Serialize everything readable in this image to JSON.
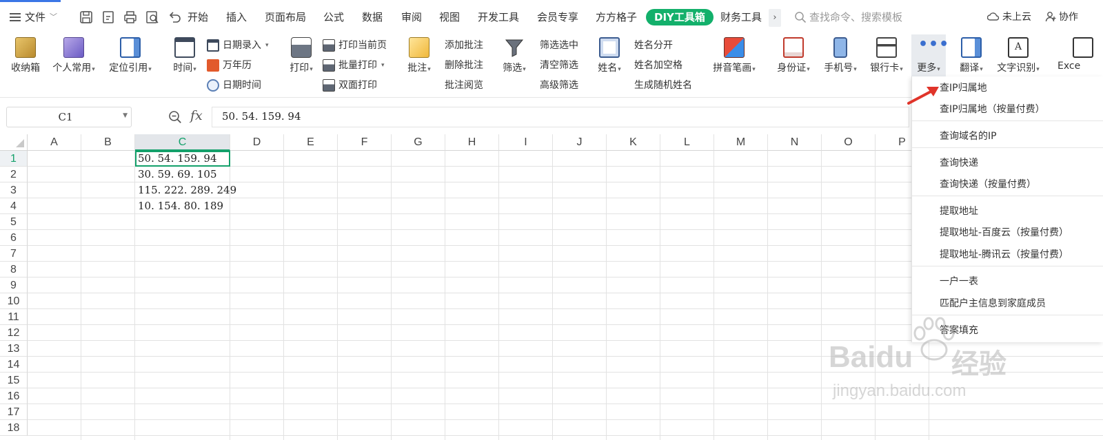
{
  "menubar": {
    "file": "文件",
    "tabs": [
      "开始",
      "插入",
      "页面布局",
      "公式",
      "数据",
      "审阅",
      "视图",
      "开发工具",
      "会员专享",
      "方方格子"
    ],
    "diy_tab": "DIY工具箱",
    "finance_tab": "财务工具",
    "more_tabs": "›",
    "search_placeholder": "查找命令、搜索模板",
    "cloud": "未上云",
    "collab": "协作"
  },
  "ribbon": {
    "toolbox": "收纳箱",
    "personal": "个人常用",
    "locate": "定位引用",
    "time": "时间",
    "date_entry": "日期录入",
    "perpetual_calendar": "万年历",
    "date_time": "日期时间",
    "print": "打印",
    "print_current": "打印当前页",
    "batch_print": "批量打印",
    "duplex_print": "双面打印",
    "annotation": "批注",
    "add_annotation": "添加批注",
    "delete_annotation": "删除批注",
    "read_annotation": "批注阅览",
    "filter": "筛选",
    "filter_selected": "筛选选中",
    "clear_filter": "清空筛选",
    "advanced_filter": "高级筛选",
    "name": "姓名",
    "split_name": "姓名分开",
    "name_add_space": "姓名加空格",
    "random_name": "生成随机姓名",
    "pinyin": "拼音笔画",
    "id_card": "身份证",
    "phone": "手机号",
    "bank_card": "银行卡",
    "more": "更多",
    "translate": "翻译",
    "ocr": "文字识别",
    "excel_cut": "Exce"
  },
  "formula": {
    "cell_ref": "C1",
    "fx": "fx",
    "value": "50. 54. 159. 94"
  },
  "grid": {
    "columns": [
      "A",
      "B",
      "C",
      "D",
      "E",
      "F",
      "G",
      "H",
      "I",
      "J",
      "K",
      "L",
      "M",
      "N",
      "O",
      "P"
    ],
    "rows": [
      "1",
      "2",
      "3",
      "4",
      "5",
      "6",
      "7",
      "8",
      "9",
      "10",
      "11",
      "12",
      "13",
      "14",
      "15",
      "16",
      "17",
      "18"
    ],
    "c_values": [
      "50. 54. 159. 94",
      "30. 59. 69. 105",
      "115. 222. 289. 249",
      "10. 154. 80. 189"
    ]
  },
  "dropdown": {
    "items": [
      "查IP归属地",
      "查IP归属地（按量付费）",
      "查询域名的IP",
      "查询快递",
      "查询快递（按量付费）",
      "提取地址",
      "提取地址-百度云（按量付费）",
      "提取地址-腾讯云（按量付费）",
      "一户一表",
      "匹配户主信息到家庭成员",
      "答案填充"
    ]
  },
  "watermark": {
    "brand": "Baidu",
    "brand_cn": "经验",
    "url": "jingyan.baidu.com"
  },
  "colors": {
    "accent": "#13b06b",
    "selection": "#13a06a",
    "arrow": "#e0342a"
  }
}
